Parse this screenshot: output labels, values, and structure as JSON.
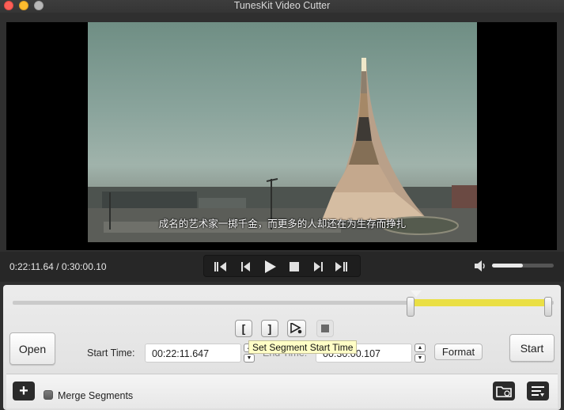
{
  "window": {
    "title": "TunesKit Video Cutter"
  },
  "video": {
    "subtitle": "成名的艺术家一掷千金，而更多的人却还在为生存而挣扎"
  },
  "transport": {
    "timecode": "0:22:11.64 / 0:30:00.10",
    "volume_level": 0.5,
    "controls": [
      "skip-to-start-icon",
      "step-back-icon",
      "play-icon",
      "stop-icon",
      "step-forward-icon",
      "skip-to-end-icon"
    ]
  },
  "timeline": {
    "segment_start_fraction": 0.74,
    "segment_end_fraction": 1.0,
    "playhead_fraction": 0.74
  },
  "segment_buttons": {
    "set_start_icon": "[",
    "set_end_icon": "]",
    "tooltip": "Set Segment Start Time"
  },
  "editor": {
    "open_label": "Open",
    "start_time_label": "Start Time:",
    "start_time_value": "00:22:11.647",
    "end_time_label": "End Time:",
    "end_time_value": "00:30:00.107",
    "format_label": "Format",
    "start_button_label": "Start"
  },
  "footer": {
    "add_icon": "+",
    "merge_label": "Merge Segments"
  },
  "colors": {
    "segment": "#eadf44",
    "panel": "#e6e6e6",
    "transport": "#272727"
  }
}
